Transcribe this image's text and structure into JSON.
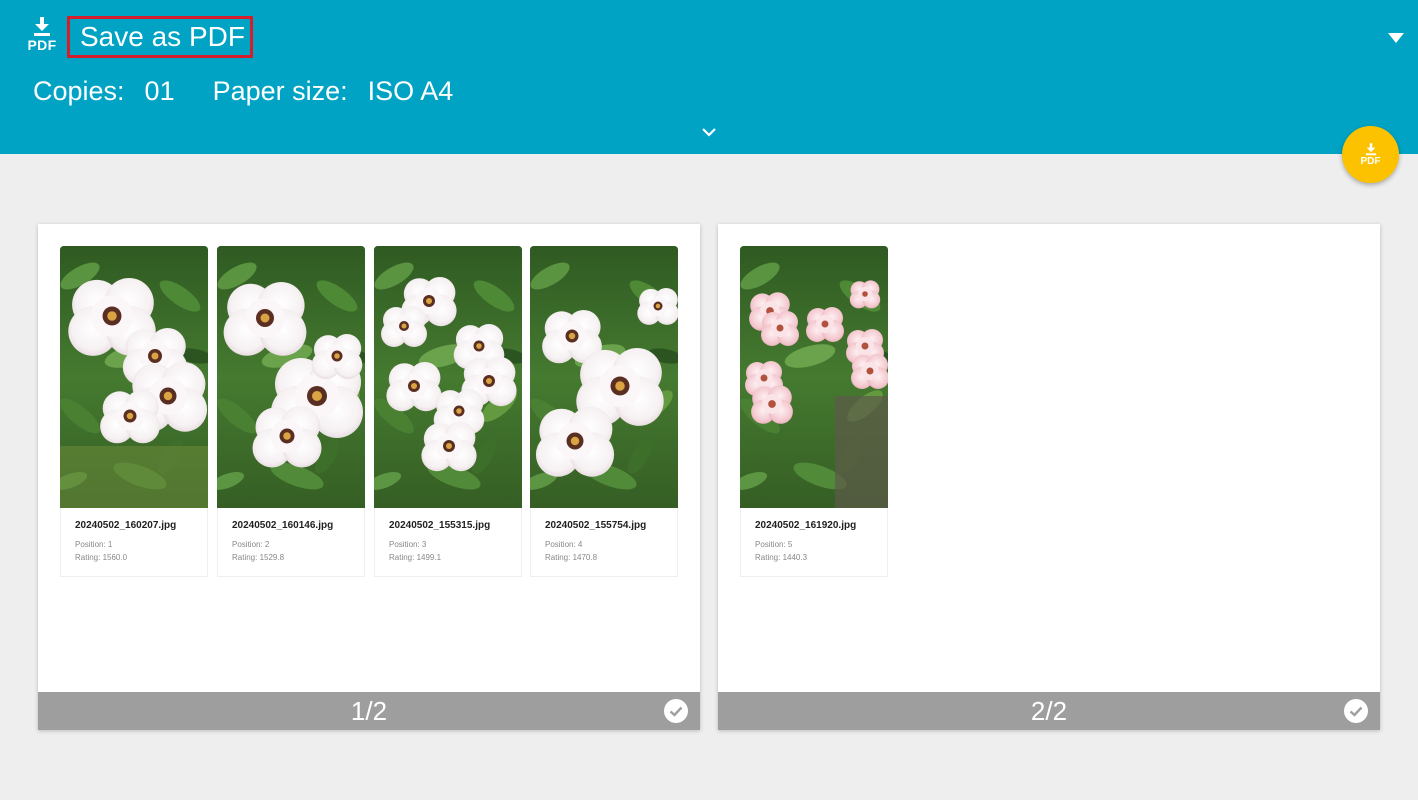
{
  "header": {
    "destination_icon": "pdf-download-icon",
    "destination_icon_text": "PDF",
    "destination_title": "Save as PDF",
    "dropdown_icon": "triangle-down-icon",
    "copies_label": "Copies:",
    "copies_value": "01",
    "paper_size_label": "Paper size:",
    "paper_size_value": "ISO A4",
    "expand_icon": "chevron-down-icon",
    "background_color": "#00a3c4",
    "highlight_color": "#d51e2b"
  },
  "fab": {
    "icon": "pdf-download-icon",
    "text": "PDF",
    "color": "#fcc200"
  },
  "pages": [
    {
      "indicator": "1/2",
      "check_icon": "check-circle-icon",
      "photos": [
        {
          "filename": "20240502_160207.jpg",
          "position": "Position: 1",
          "rating": "Rating: 1560.0"
        },
        {
          "filename": "20240502_160146.jpg",
          "position": "Position: 2",
          "rating": "Rating: 1529.8"
        },
        {
          "filename": "20240502_155315.jpg",
          "position": "Position: 3",
          "rating": "Rating: 1499.1"
        },
        {
          "filename": "20240502_155754.jpg",
          "position": "Position: 4",
          "rating": "Rating: 1470.8"
        }
      ]
    },
    {
      "indicator": "2/2",
      "check_icon": "check-circle-icon",
      "photos": [
        {
          "filename": "20240502_161920.jpg",
          "position": "Position: 5",
          "rating": "Rating: 1440.3"
        }
      ]
    }
  ]
}
